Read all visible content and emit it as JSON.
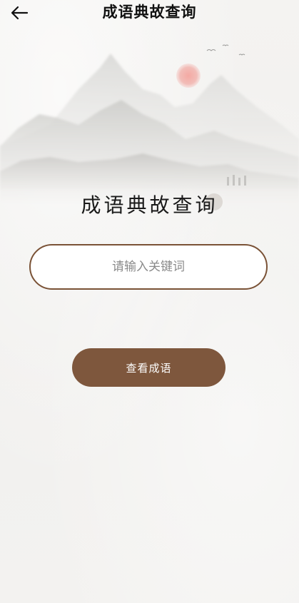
{
  "header": {
    "title": "成语典故查询",
    "back_icon": "arrow-left-icon"
  },
  "hero": {
    "calligraphy_title": "成语典故查询",
    "sun_color": "#f2b8b4"
  },
  "search": {
    "placeholder": "请输入关键词",
    "value": ""
  },
  "actions": {
    "submit_label": "查看成语"
  },
  "colors": {
    "accent_brown": "#7e573d",
    "border_brown": "#7a5236",
    "background": "#f3f2f0"
  }
}
